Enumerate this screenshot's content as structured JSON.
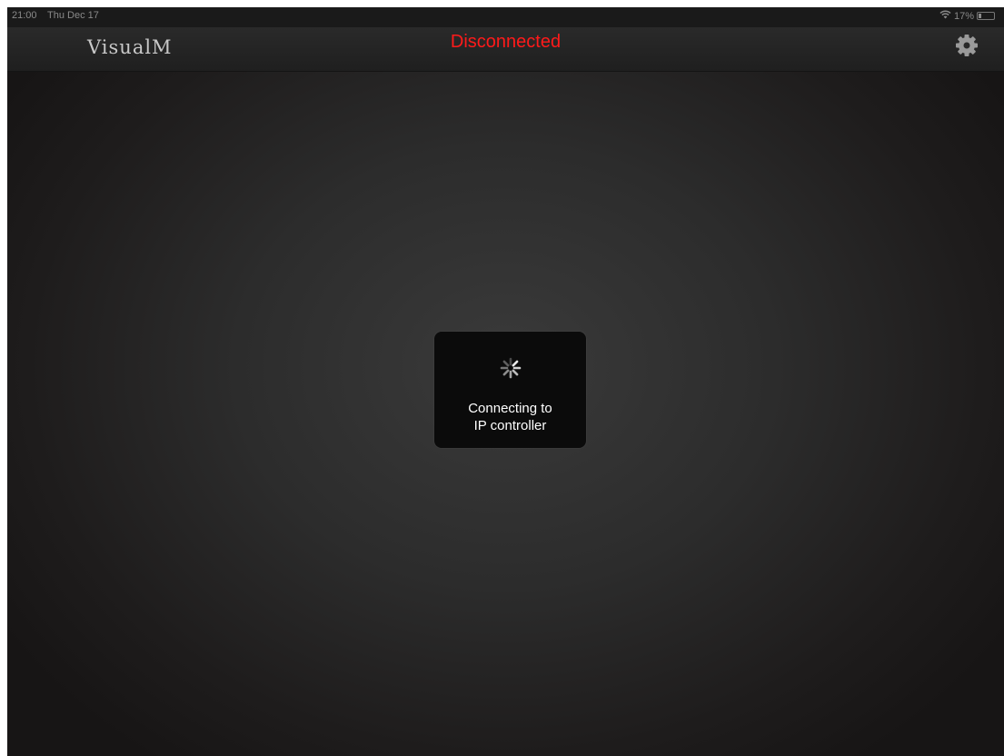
{
  "status_bar": {
    "time": "21:00",
    "date": "Thu Dec 17",
    "wifi_icon": "wifi-icon",
    "battery_percent": "17%",
    "battery_level": 0.17
  },
  "nav": {
    "app_name": "VisualM",
    "connection_status": "Disconnected",
    "status_color": "#ff1a1a",
    "settings_icon": "gear-icon"
  },
  "loading": {
    "spinner_icon": "activity-spinner-icon",
    "line1": "Connecting to",
    "line2": "IP controller"
  }
}
